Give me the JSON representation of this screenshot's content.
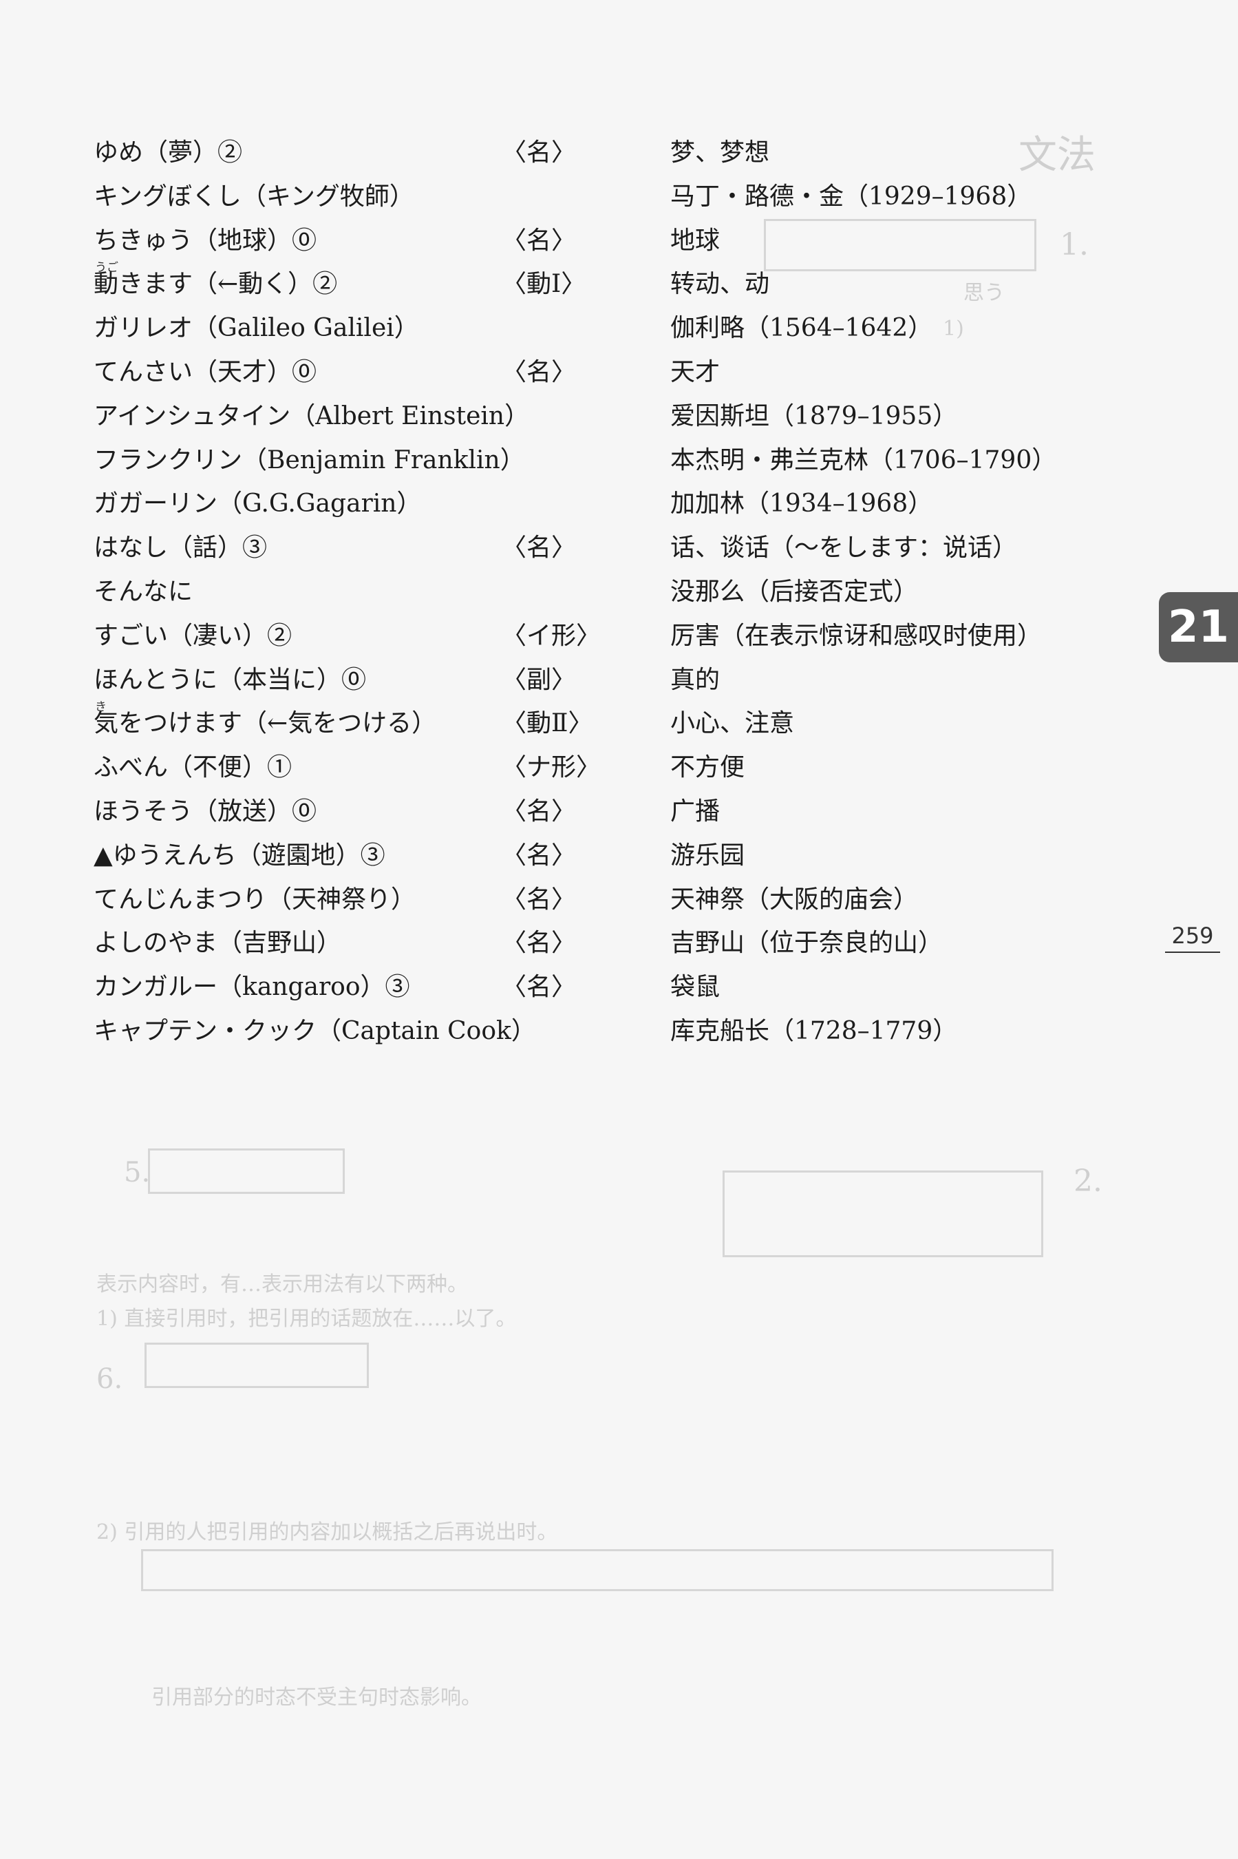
{
  "vocabulary": [
    {
      "term": "ゆめ（夢）②",
      "pos": "〈名〉",
      "meaning": "梦、梦想"
    },
    {
      "term": "キングぼくし（キング牧師）",
      "pos": "",
      "meaning": "马丁・路德・金（1929–1968）"
    },
    {
      "term": "ちきゅう（地球）⓪",
      "pos": "〈名〉",
      "meaning": "地球"
    },
    {
      "term": "動きます（←動く）②",
      "ruby": "うご",
      "pos": "〈動Ⅰ〉",
      "meaning": "转动、动"
    },
    {
      "term": "ガリレオ（Galileo Galilei）",
      "pos": "",
      "meaning": "伽利略（1564–1642）"
    },
    {
      "term": "てんさい（天才）⓪",
      "pos": "〈名〉",
      "meaning": "天才"
    },
    {
      "term": "アインシュタイン（Albert Einstein）",
      "pos": "",
      "meaning": "爱因斯坦（1879–1955）"
    },
    {
      "term": "フランクリン（Benjamin Franklin）",
      "pos": "",
      "meaning": "本杰明・弗兰克林（1706–1790）"
    },
    {
      "term": "ガガーリン（G.G.Gagarin）",
      "pos": "",
      "meaning": "加加林（1934–1968）"
    },
    {
      "term": "はなし（話）③",
      "pos": "〈名〉",
      "meaning": "话、谈话（～をします：说话）"
    },
    {
      "term": "そんなに",
      "pos": "",
      "meaning": "没那么（后接否定式）"
    },
    {
      "term": "すごい（凄い）②",
      "pos": "〈イ形〉",
      "meaning": "厉害（在表示惊讶和感叹时使用）"
    },
    {
      "term": "ほんとうに（本当に）⓪",
      "pos": "〈副〉",
      "meaning": "真的"
    },
    {
      "term": "気をつけます（←気をつける）",
      "ruby": "き",
      "pos": "〈動Ⅱ〉",
      "meaning": "小心、注意"
    },
    {
      "term": "ふべん（不便）①",
      "pos": "〈ナ形〉",
      "meaning": "不方便"
    },
    {
      "term": "ほうそう（放送）⓪",
      "pos": "〈名〉",
      "meaning": "广播"
    },
    {
      "term": "▲ゆうえんち（遊園地）③",
      "pos": "〈名〉",
      "meaning": "游乐园"
    },
    {
      "term": "てんじんまつり（天神祭り）",
      "pos": "〈名〉",
      "meaning": "天神祭（大阪的庙会）"
    },
    {
      "term": "よしのやま（吉野山）",
      "pos": "〈名〉",
      "meaning": "吉野山（位于奈良的山）"
    },
    {
      "term": "カンガルー（kangaroo）③",
      "pos": "〈名〉",
      "meaning": "袋鼠"
    },
    {
      "term": "キャプテン・クック（Captain Cook）",
      "pos": "",
      "meaning": "库克船长（1728–1779）"
    }
  ],
  "chapter_tab": "21",
  "page_number": "259",
  "colors": {
    "background": "#f6f6f6",
    "text": "#1c1c1c",
    "tab": "#5a5a5a"
  }
}
